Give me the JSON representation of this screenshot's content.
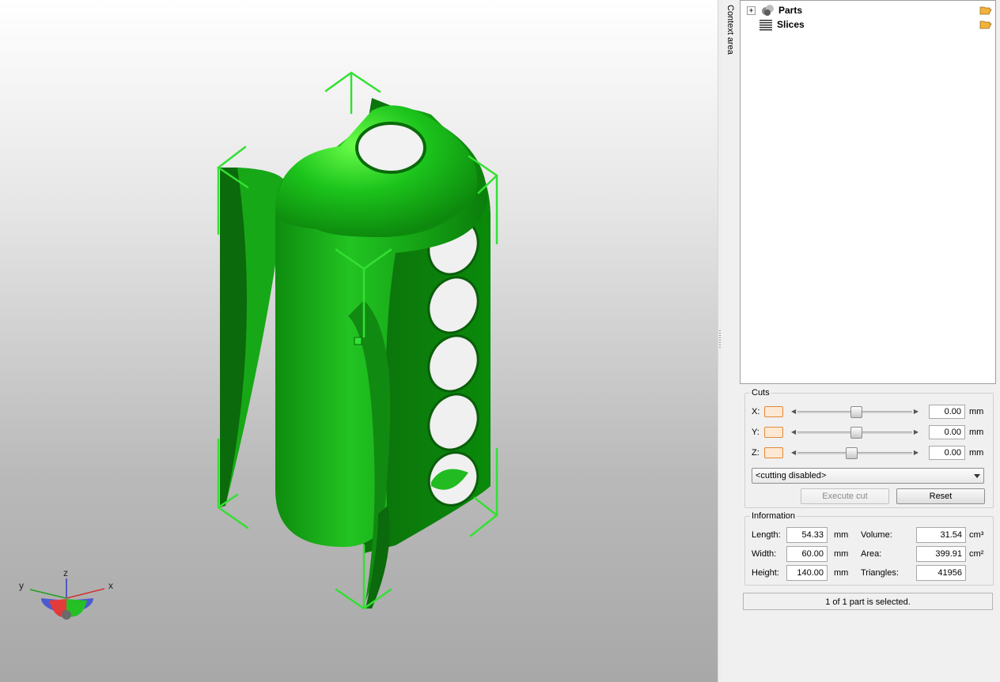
{
  "context_tab": {
    "label": "Context area"
  },
  "tree": {
    "items": [
      {
        "label": "Parts",
        "expander": "+",
        "icon": "parts-icon"
      },
      {
        "label": "Slices",
        "icon": "slices-icon"
      }
    ]
  },
  "cuts": {
    "title": "Cuts",
    "rows": [
      {
        "axis": "X:",
        "value": "0.00",
        "unit": "mm",
        "position": 0.49
      },
      {
        "axis": "Y:",
        "value": "0.00",
        "unit": "mm",
        "position": 0.49
      },
      {
        "axis": "Z:",
        "value": "0.00",
        "unit": "mm",
        "position": 0.45
      }
    ],
    "mode": "<cutting disabled>",
    "execute_label": "Execute cut",
    "reset_label": "Reset"
  },
  "info": {
    "title": "Information",
    "length_label": "Length:",
    "length": "54.33",
    "length_unit": "mm",
    "width_label": "Width:",
    "width": "60.00",
    "width_unit": "mm",
    "height_label": "Height:",
    "height": "140.00",
    "height_unit": "mm",
    "volume_label": "Volume:",
    "volume": "31.54",
    "volume_unit": "cm³",
    "area_label": "Area:",
    "area": "399.91",
    "area_unit": "cm²",
    "triangles_label": "Triangles:",
    "triangles": "41956"
  },
  "status": "1 of 1 part is selected.",
  "axes_gizmo": {
    "x": "x",
    "y": "y",
    "z": "z"
  },
  "colors": {
    "model": "#1fc81f",
    "selection": "#33e033",
    "accent_toggle": "#e08a3a"
  }
}
